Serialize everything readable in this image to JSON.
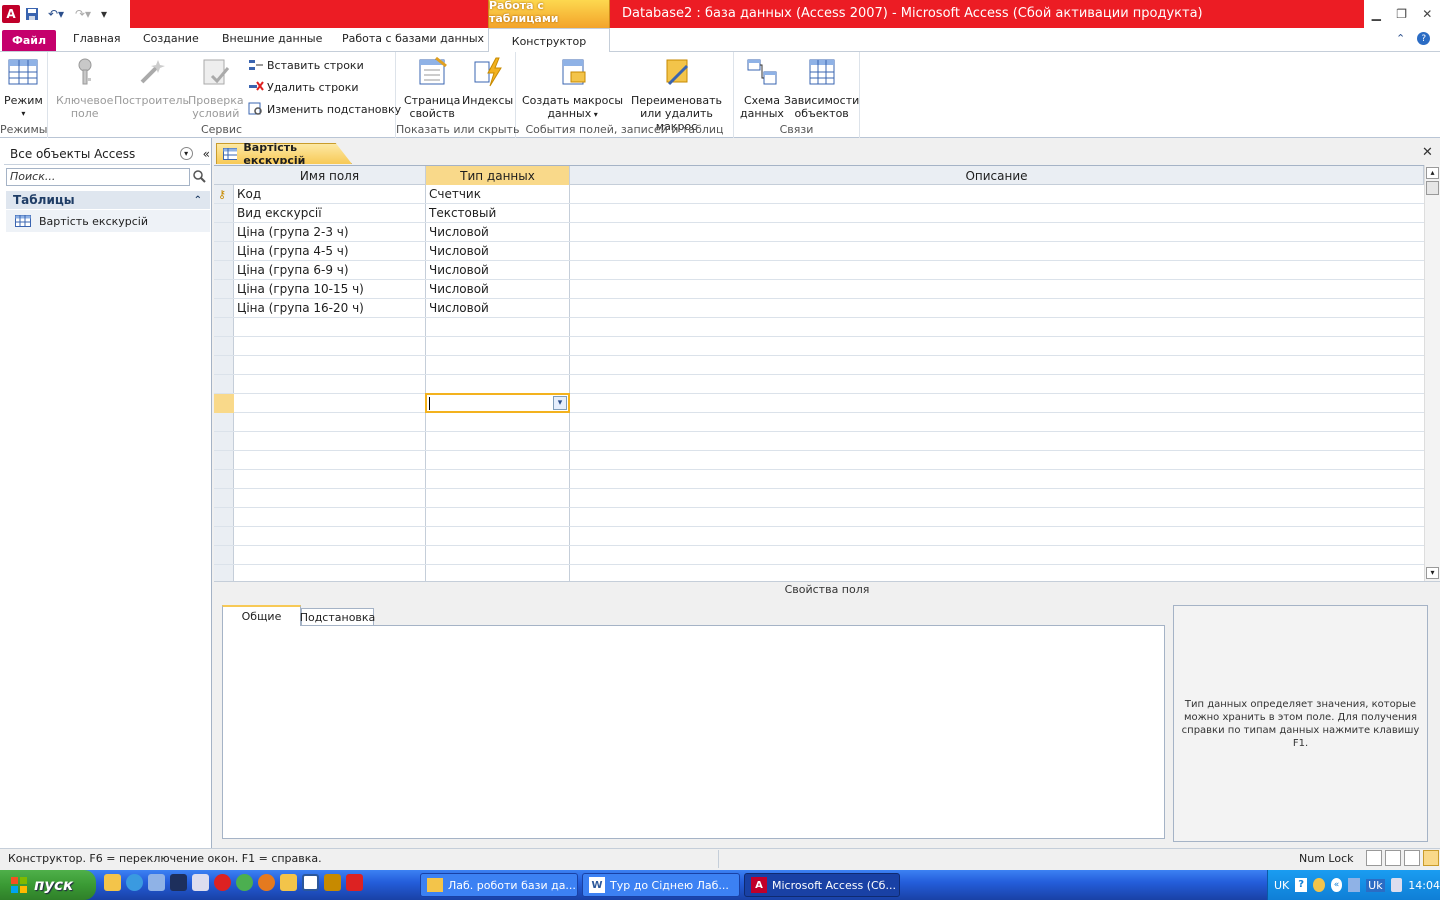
{
  "title_bar": {
    "context_tab": "Работа с таблицами",
    "window_title": "Database2 : база данных (Access 2007)  -  Microsoft Access (Сбой активации продукта)"
  },
  "ribbon_tabs": {
    "file": "Файл",
    "tabs": [
      "Главная",
      "Создание",
      "Внешние данные",
      "Работа с базами данных"
    ],
    "active": "Конструктор"
  },
  "ribbon": {
    "groups": {
      "modes": "Режимы",
      "service": "Сервис",
      "show_hide": "Показать или скрыть",
      "events": "События полей, записей и таблиц",
      "relations": "Связи"
    },
    "buttons": {
      "mode": "Режим",
      "key_field_1": "Ключевое",
      "key_field_2": "поле",
      "builder": "Построитель",
      "validate_1": "Проверка",
      "validate_2": "условий",
      "insert_rows": "Вставить строки",
      "delete_rows": "Удалить строки",
      "modify_lookup": "Изменить подстановку",
      "property_sheet_1": "Страница",
      "property_sheet_2": "свойств",
      "indexes": "Индексы",
      "create_macros_1": "Создать макросы",
      "create_macros_2": "данных",
      "rename_macro_1": "Переименовать",
      "rename_macro_2": "или удалить макрос",
      "schema_1": "Схема",
      "schema_2": "данных",
      "dependencies_1": "Зависимости",
      "dependencies_2": "объектов"
    }
  },
  "nav_pane": {
    "header": "Все объекты Access",
    "search_placeholder": "Поиск...",
    "group": "Таблицы",
    "items": [
      "Вартість екскурсій"
    ]
  },
  "document": {
    "tab": "Вартість екскурсій",
    "columns": [
      "Имя поля",
      "Тип данных",
      "Описание"
    ],
    "rows": [
      {
        "name": "Код",
        "type": "Счетчик",
        "key": true
      },
      {
        "name": "Вид екскурсії",
        "type": "Текстовый"
      },
      {
        "name": "Ціна (група 2-3 ч)",
        "type": "Числовой"
      },
      {
        "name": "Ціна (група 4-5 ч)",
        "type": "Числовой"
      },
      {
        "name": "Ціна (група 6-9 ч)",
        "type": "Числовой"
      },
      {
        "name": "Ціна (група 10-15 ч)",
        "type": "Числовой"
      },
      {
        "name": "Ціна (група 16-20 ч)",
        "type": "Числовой"
      }
    ],
    "field_properties_label": "Свойства поля",
    "property_tabs": [
      "Общие",
      "Подстановка"
    ],
    "help_text": "Тип данных определяет значения, которые можно хранить в этом поле. Для получения справки по типам данных нажмите клавишу F1."
  },
  "status_bar": {
    "text": "Конструктор.  F6 = переключение окон.  F1 = справка.",
    "num_lock": "Num Lock"
  },
  "taskbar": {
    "start": "пуск",
    "windows": [
      "Лаб. роботи бази да...",
      "Тур до Сіднею Лаб...",
      "Microsoft Access (Сб..."
    ],
    "lang": "UK",
    "lang2": "Uk",
    "clock": "14:04"
  },
  "colors": {
    "title_red": "#ec1c24",
    "file_tab": "#c5006c",
    "context_orange": "#f3a32a",
    "taskbar_blue": "#245edb",
    "start_green": "#3a9a34"
  }
}
